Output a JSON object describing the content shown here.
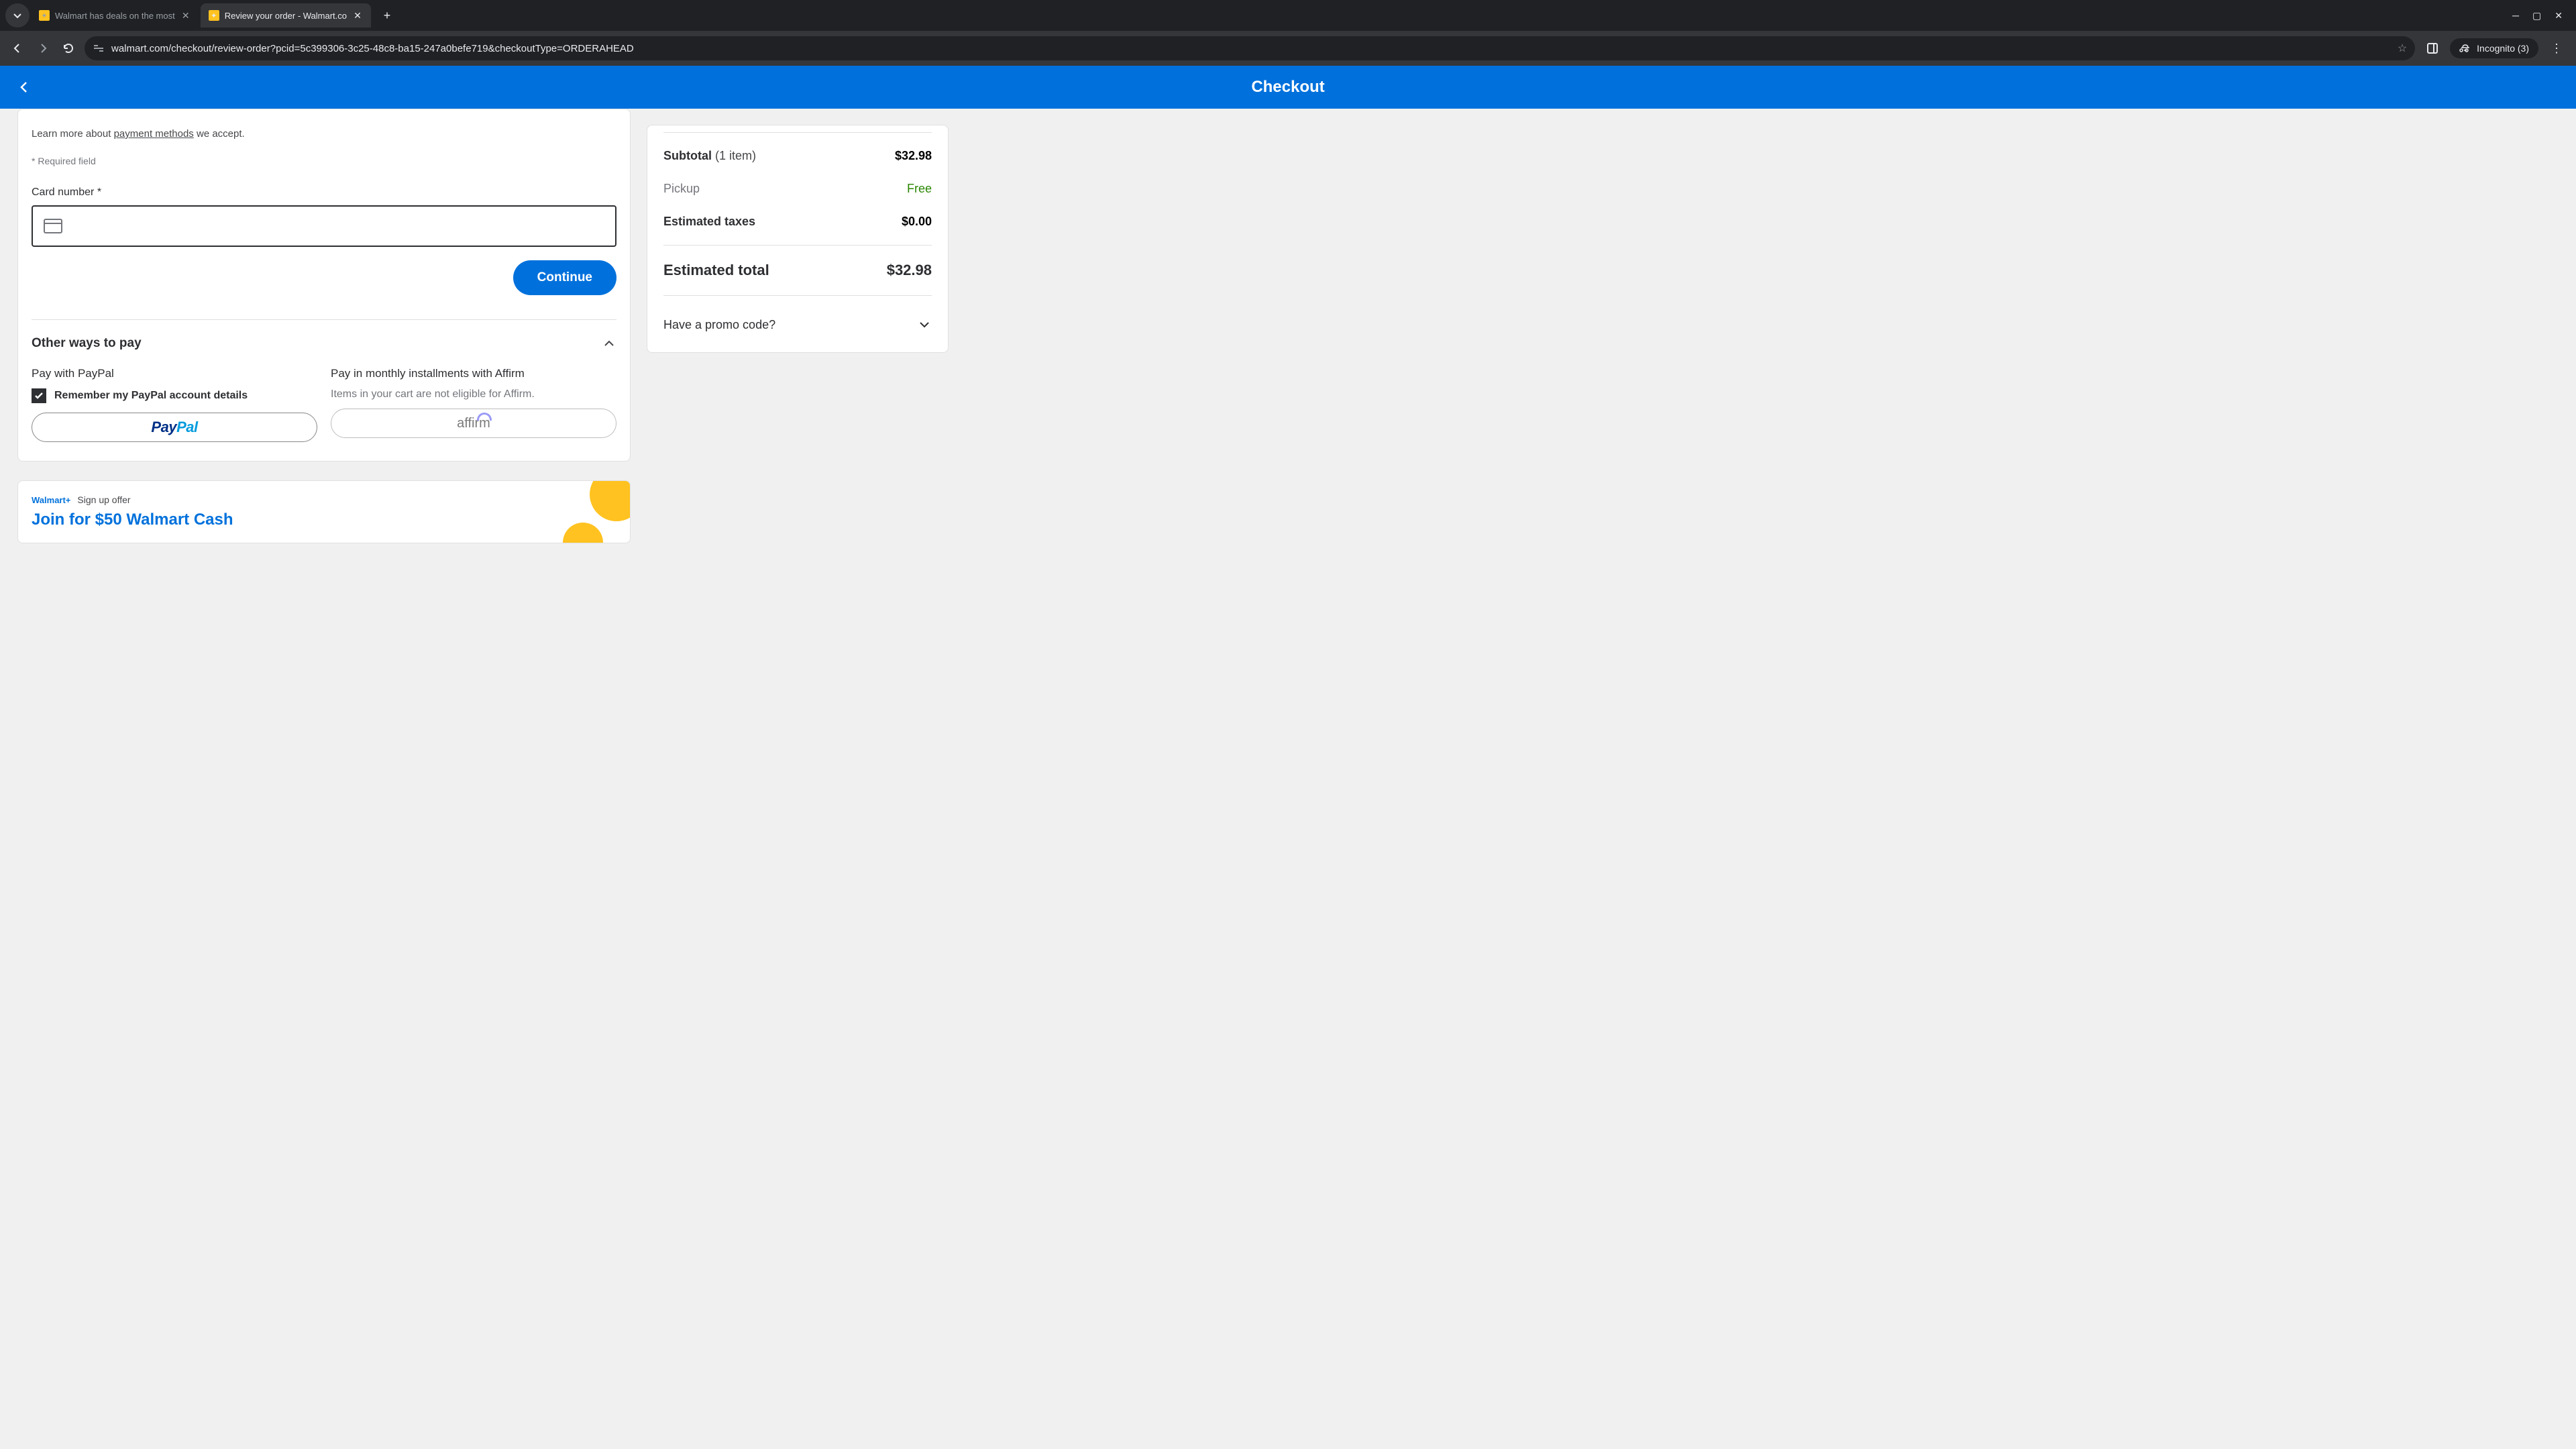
{
  "browser": {
    "tabs": [
      {
        "title": "Walmart has deals on the most",
        "active": false
      },
      {
        "title": "Review your order - Walmart.co",
        "active": true
      }
    ],
    "url": "walmart.com/checkout/review-order?pcid=5c399306-3c25-48c8-ba15-247a0befe719&checkoutType=ORDERAHEAD",
    "incognito_label": "Incognito (3)"
  },
  "header": {
    "title": "Checkout"
  },
  "payment": {
    "learn_prefix": "Learn more about ",
    "learn_link": "payment methods",
    "learn_suffix": " we accept.",
    "required_note": "* Required field",
    "card_label": "Card number *",
    "continue_label": "Continue"
  },
  "other_ways": {
    "heading": "Other ways to pay",
    "paypal": {
      "title": "Pay with PayPal",
      "remember_label": "Remember my PayPal account details",
      "remember_checked": true
    },
    "affirm": {
      "title": "Pay in monthly installments with Affirm",
      "note": "Items in your cart are not eligible for Affirm."
    }
  },
  "promo_banner": {
    "badge": "Walmart+",
    "sub": "Sign up offer",
    "headline": "Join for $50 Walmart Cash"
  },
  "summary": {
    "subtotal_label": "Subtotal",
    "subtotal_count": "(1 item)",
    "subtotal_value": "$32.98",
    "pickup_label": "Pickup",
    "pickup_value": "Free",
    "taxes_label": "Estimated taxes",
    "taxes_value": "$0.00",
    "total_label": "Estimated total",
    "total_value": "$32.98",
    "promo_label": "Have a promo code?"
  }
}
